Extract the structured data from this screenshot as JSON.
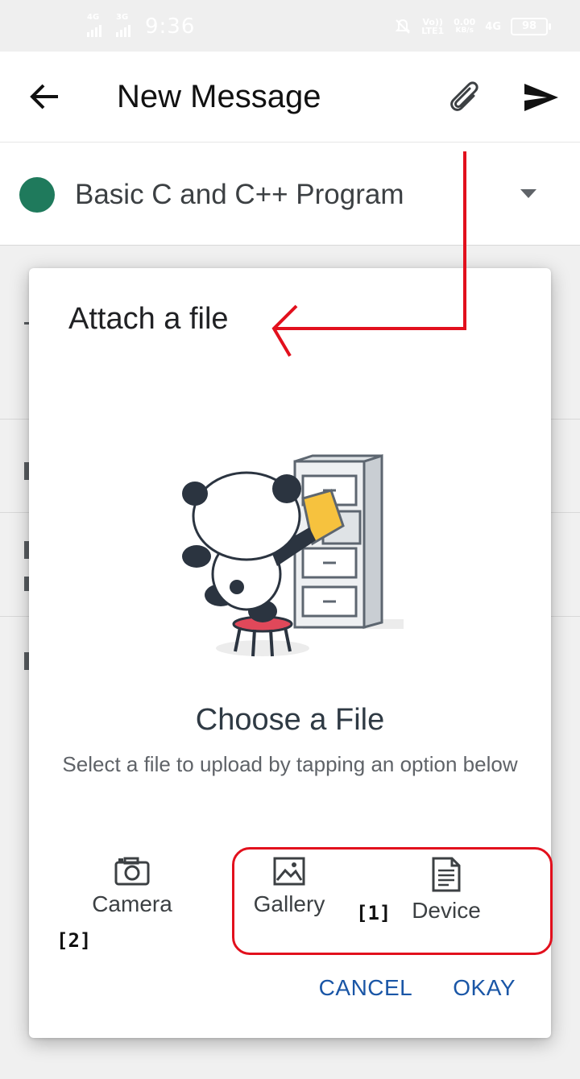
{
  "status_bar": {
    "net1": "4G",
    "net2": "3G",
    "time": "9:36",
    "volte_top": "Vo))",
    "volte_bottom": "LTE1",
    "speed_top": "0.00",
    "speed_bottom": "KB/s",
    "net3": "4G",
    "battery": "98"
  },
  "app_bar": {
    "title": "New Message",
    "back_icon": "arrow-back",
    "attach_icon": "paperclip",
    "send_icon": "send"
  },
  "group_selector": {
    "name": "Basic C and C++ Program",
    "dot_color": "#1f7a5c"
  },
  "dialog": {
    "title": "Attach a file",
    "heading": "Choose a File",
    "subtext": "Select a file to upload by tapping an option below",
    "options": [
      {
        "label": "Camera",
        "icon": "camera"
      },
      {
        "label": "Gallery",
        "icon": "image"
      },
      {
        "label": "Device",
        "icon": "document"
      }
    ],
    "cancel_label": "CANCEL",
    "okay_label": "OKAY"
  },
  "annotations": {
    "tag1": "[1]",
    "tag2": "[2]",
    "color": "#e2101d"
  }
}
